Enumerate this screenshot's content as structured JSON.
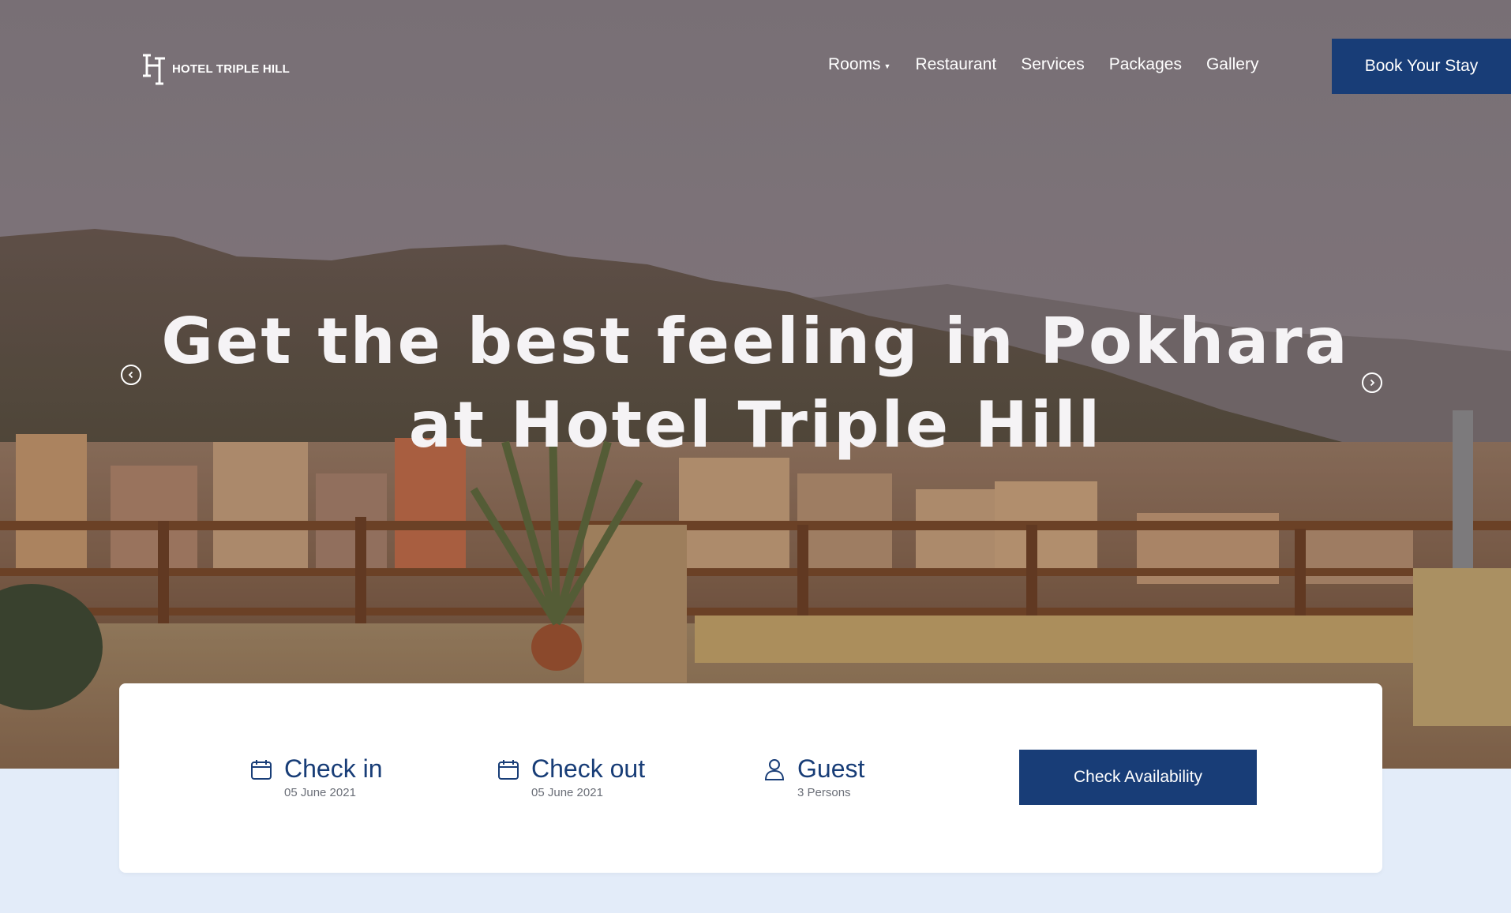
{
  "header": {
    "logo_text": "HOTEL TRIPLE HILL",
    "nav": [
      {
        "label": "Rooms",
        "has_dropdown": true
      },
      {
        "label": "Restaurant"
      },
      {
        "label": "Services"
      },
      {
        "label": "Packages"
      },
      {
        "label": "Gallery"
      }
    ],
    "book_label": "Book Your Stay"
  },
  "hero": {
    "headline_line1": "Get the best feeling in Pokhara",
    "headline_line2": "at Hotel Triple Hill",
    "prev_icon": "chevron-left-circle-icon",
    "next_icon": "chevron-right-circle-icon"
  },
  "booking": {
    "checkin": {
      "title": "Check in",
      "value": "05 June 2021",
      "icon": "calendar-icon"
    },
    "checkout": {
      "title": "Check out",
      "value": "05 June 2021",
      "icon": "calendar-icon"
    },
    "guest": {
      "title": "Guest",
      "value": "3 Persons",
      "icon": "user-icon"
    },
    "button_label": "Check Availability"
  },
  "colors": {
    "brand": "#183d77",
    "page_background": "#e3ecf9",
    "card": "#ffffff"
  }
}
